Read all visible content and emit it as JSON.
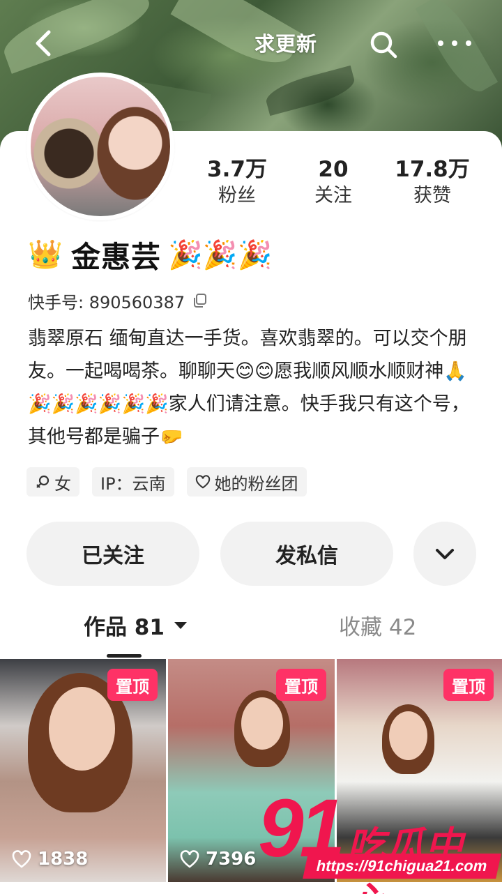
{
  "header": {
    "title": "求更新",
    "back_icon": "back-arrow-icon",
    "search_icon": "search-icon",
    "more_icon": "more-dots-icon"
  },
  "profile": {
    "stats": [
      {
        "value": "3.7万",
        "label": "粉丝"
      },
      {
        "value": "20",
        "label": "关注"
      },
      {
        "value": "17.8万",
        "label": "获赞"
      }
    ],
    "name_prefix_emoji": "👑",
    "name": "金惠芸",
    "name_suffix_emoji": "🎉🎉🎉",
    "kwai_id_label": "快手号: 890560387",
    "bio": "翡翠原石 缅甸直达一手货。喜欢翡翠的。可以交个朋友。一起喝喝茶。聊聊天😊😊愿我顺风顺水顺财神🙏🎉🎉🎉🎉🎉🎉家人们请注意。快手我只有这个号，其他号都是骗子🤛",
    "tags": [
      {
        "icon": "female-icon",
        "label": "女"
      },
      {
        "icon": "",
        "label": "IP：云南"
      },
      {
        "icon": "heart-outline-icon",
        "label": "她的粉丝团"
      }
    ]
  },
  "actions": {
    "follow_label": "已关注",
    "message_label": "发私信",
    "more_icon": "chevron-down-icon"
  },
  "tabs": {
    "works_label": "作品 81",
    "favorites_label": "收藏 42"
  },
  "videos": [
    {
      "badge": "置顶",
      "likes": "1838"
    },
    {
      "badge": "置顶",
      "likes": "7396"
    },
    {
      "badge": "置顶",
      "likes": ""
    }
  ],
  "watermark": {
    "brand_number": "91",
    "brand_text": "吃瓜中心",
    "url": "https://91chigua21.com"
  },
  "colors": {
    "badge_bg": "#fe3266",
    "watermark": "#f0164e",
    "button_bg": "#f2f2f2"
  }
}
